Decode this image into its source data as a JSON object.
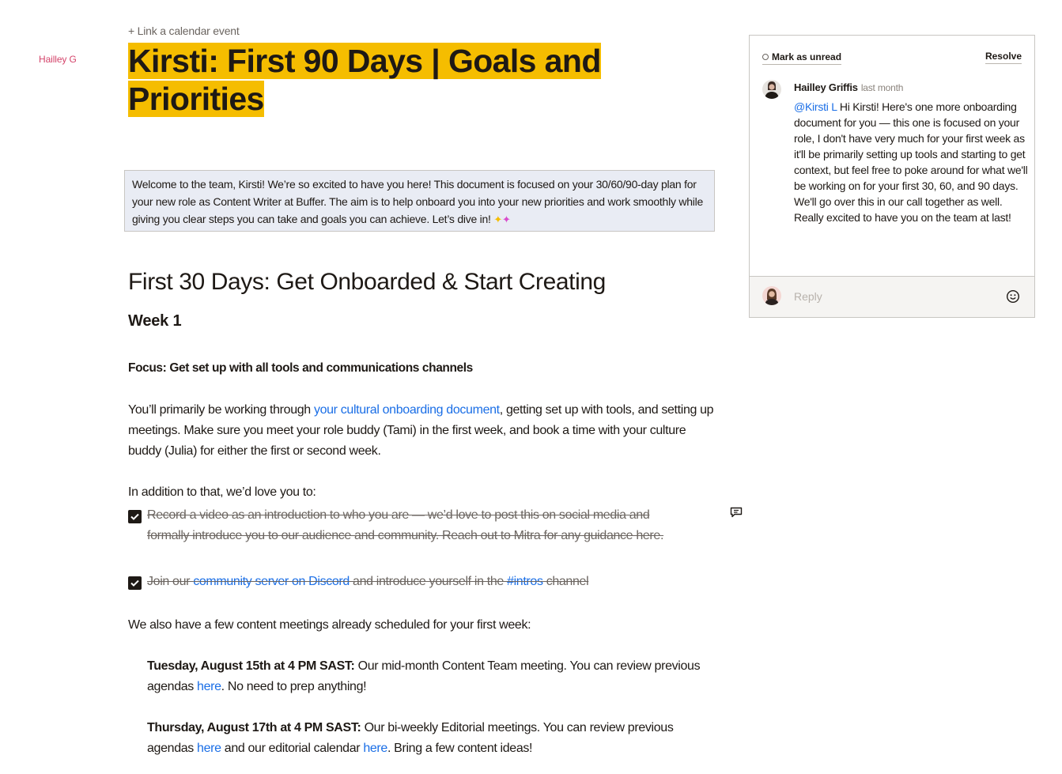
{
  "gutter": {
    "author": "Hailley G"
  },
  "header": {
    "calendar_link": "+ Link a calendar event",
    "title": "Kirsti: First 90 Days | Goals and Priorities"
  },
  "colors": {
    "title_highlight": "#f5bd00",
    "callout_bg": "#e9ecf4",
    "link": "#1a6ee6",
    "author_gutter": "#d4436a"
  },
  "callout": {
    "text": "Welcome to the team, Kirsti! We’re so excited to have you here! This document is focused on your 30/60/90-day plan for your new role as Content Writer at Buffer. The aim is to help onboard you into your new priorities and work smoothly while giving you clear steps you can take and goals you can achieve. Let’s dive in! ",
    "emoji": "sparkles-icon"
  },
  "section": {
    "heading": "First 30 Days: Get Onboarded & Start Creating",
    "subheading": "Week 1",
    "focus": "Focus: Get set up with all tools and communications channels",
    "p1_before": "You’ll primarily be working through ",
    "p1_link": "your cultural onboarding document",
    "p1_after": ", getting set up with tools, and setting up meetings. Make sure you meet your role buddy (Tami) in the first week, and book a time with your culture buddy (Julia) for either the first or second week.",
    "p2": "In addition to that, we’d love you to:",
    "todos": [
      {
        "checked": true,
        "text": "Record a video as an introduction to who you are — we’d love to post this on social media and formally introduce you to our audience and community. Reach out to Mitra for any guidance here."
      },
      {
        "checked": true,
        "before": "Join our ",
        "link1": "community server on Discord",
        "middle": " and introduce yourself in the ",
        "link2": "#intros",
        "after": " channel"
      }
    ],
    "p3": "We also have a few content meetings already scheduled for your first week:",
    "meetings": [
      {
        "when": "Tuesday, August 15th at 4 PM SAST:",
        "text1": " Our mid-month Content Team meeting. You can review previous agendas ",
        "link1": "here",
        "text2": ". No need to prep anything!"
      },
      {
        "when": "Thursday, August 17th at 4 PM SAST:",
        "text1": " Our bi-weekly Editorial meetings. You can review previous agendas ",
        "link1": "here",
        "text2": " and our editorial calendar ",
        "link2": "here",
        "text3": ". Bring a few content ideas!"
      }
    ]
  },
  "comment_panel": {
    "mark_unread": "Mark as unread",
    "resolve": "Resolve",
    "comment": {
      "author": "Hailley Griffis",
      "time": "last month",
      "mention": "@Kirsti L",
      "body": " Hi Kirsti! Here's one more onboarding document for you — this one is focused on your role, I don't have very much for your first week as it'll be primarily setting up tools and starting to get context, but feel free to poke around for what we'll be working on for your first 30, 60, and 90 days. We'll go over this in our call together as well. Really excited to have you on the team at last!"
    },
    "reply": {
      "placeholder": "Reply",
      "value": ""
    }
  }
}
